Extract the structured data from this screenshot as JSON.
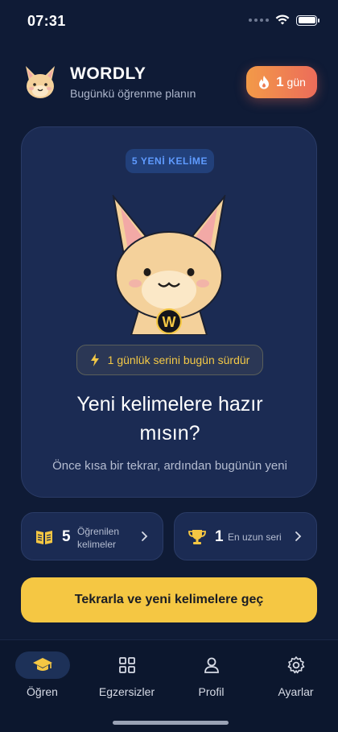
{
  "status_bar": {
    "time": "07:31"
  },
  "header": {
    "title": "WORDLY",
    "subtitle": "Bugünkü öğrenme planın",
    "streak_count": "1",
    "streak_unit": "gün"
  },
  "hero": {
    "badge": "5 YENİ KELİME",
    "serie_text": "1 günlük serini bugün sürdür",
    "title": "Yeni kelimelere hazır mısın?",
    "description": "Önce kısa bir tekrar, ardından bugünün yeni"
  },
  "stats": {
    "learned": {
      "value": "5",
      "label": "Öğrenilen kelimeler"
    },
    "longest": {
      "value": "1",
      "label": "En uzun seri"
    }
  },
  "cta": {
    "label": "Tekrarla ve yeni kelimelere geç"
  },
  "nav": {
    "items": [
      {
        "label": "Öğren",
        "icon": "graduation-cap-icon",
        "active": true
      },
      {
        "label": "Egzersizler",
        "icon": "grid-icon",
        "active": false
      },
      {
        "label": "Profil",
        "icon": "user-icon",
        "active": false
      },
      {
        "label": "Ayarlar",
        "icon": "gear-icon",
        "active": false
      }
    ]
  },
  "colors": {
    "background": "#0f1b36",
    "card": "#1b2b53",
    "accent_yellow": "#f5c743",
    "streak_gradient_start": "#f39a48",
    "streak_gradient_end": "#ec6c5a",
    "badge_blue": "#5f9bff"
  }
}
